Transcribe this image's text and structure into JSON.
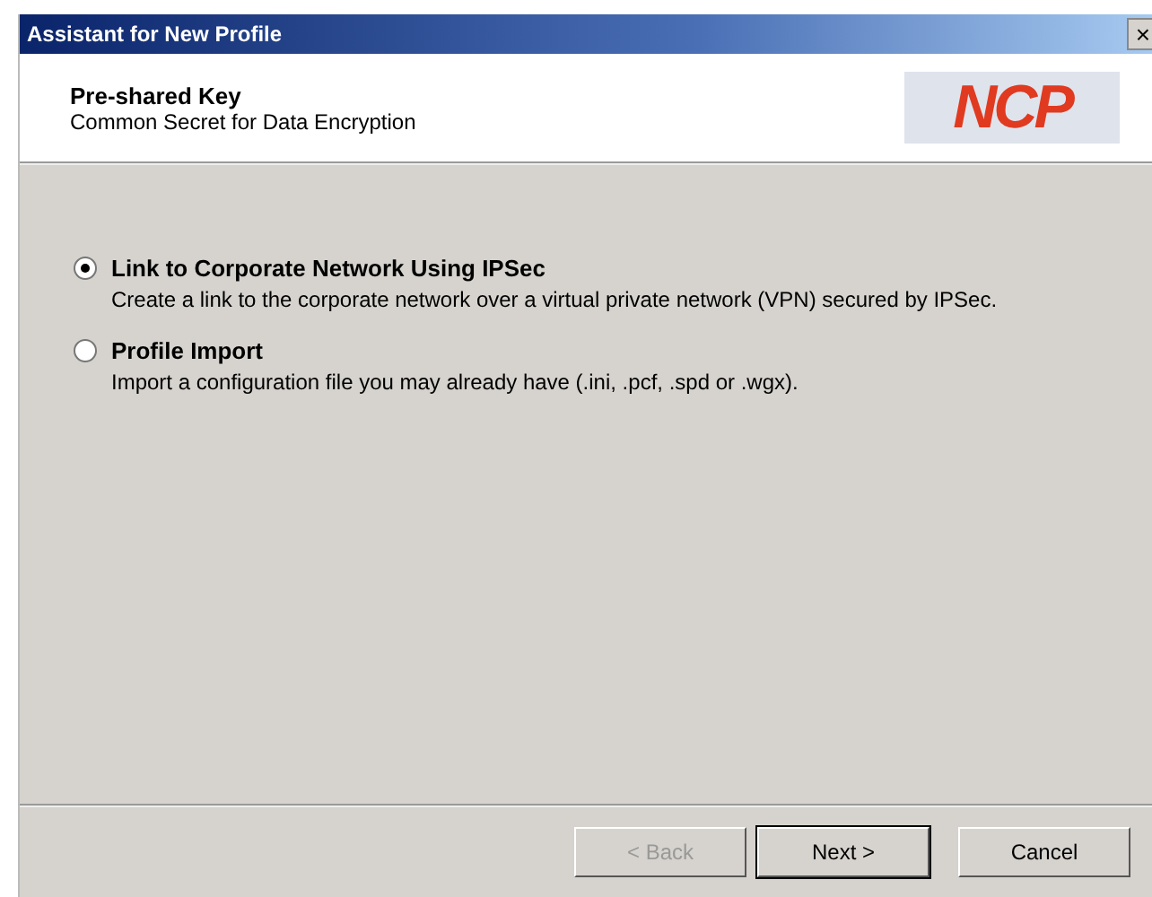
{
  "window": {
    "title": "Assistant for New Profile",
    "close": "×"
  },
  "header": {
    "title": "Pre-shared Key",
    "subtitle": "Common Secret for Data Encryption",
    "logo": "NCP"
  },
  "options": [
    {
      "label": "Link to Corporate Network Using IPSec",
      "description": "Create a link to the corporate network over a virtual private network (VPN) secured by IPSec.",
      "selected": true
    },
    {
      "label": "Profile Import",
      "description": "Import a configuration file you may already have (.ini, .pcf, .spd or .wgx).",
      "selected": false
    }
  ],
  "buttons": [
    {
      "label": "< Back",
      "disabled": true,
      "default": false
    },
    {
      "label": "Next >",
      "disabled": false,
      "default": true
    },
    {
      "label": "Cancel",
      "disabled": false,
      "default": false
    }
  ]
}
